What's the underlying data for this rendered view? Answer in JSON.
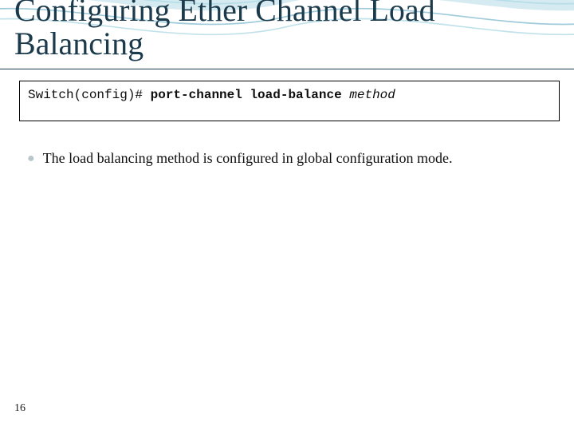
{
  "title": "Configuring Ether Channel Load Balancing",
  "code": {
    "prompt": "Switch(config)# ",
    "command": "port-channel load-balance ",
    "arg": "method"
  },
  "bullets": [
    "The load balancing method is configured in global configuration mode."
  ],
  "page_number": "16"
}
